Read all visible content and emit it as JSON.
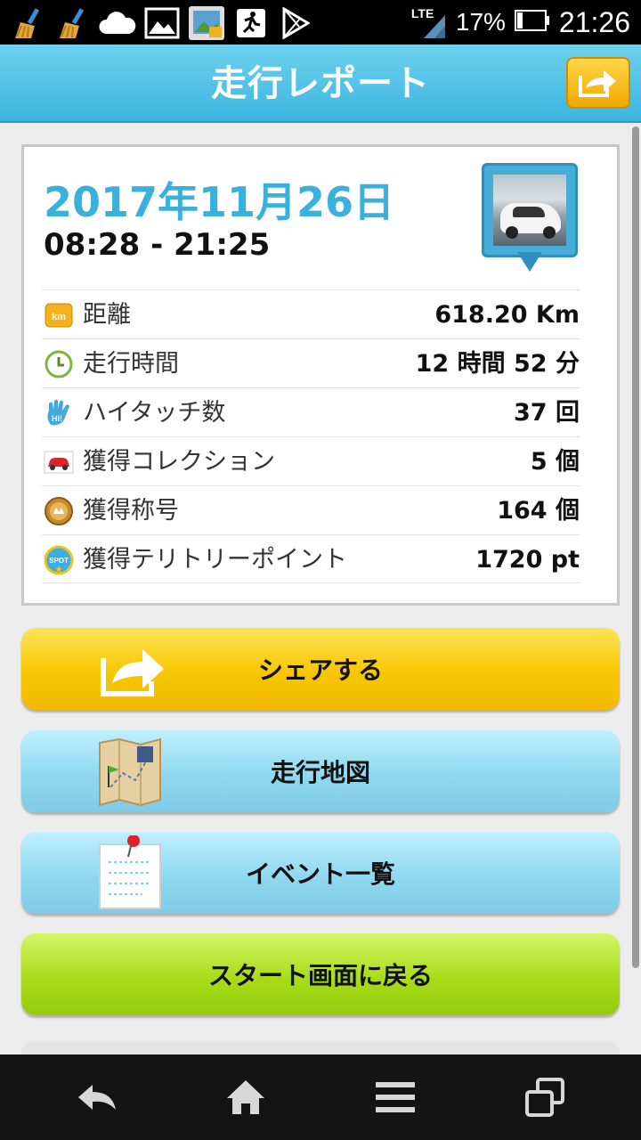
{
  "status_bar": {
    "network": "LTE",
    "battery": "17%",
    "time": "21:26",
    "icons": [
      "broom-icon",
      "broom-icon",
      "cloud-icon",
      "image-icon",
      "photo-icon",
      "running-icon",
      "play-store-icon"
    ]
  },
  "header": {
    "title": "走行レポート",
    "share_icon": "share-icon"
  },
  "report": {
    "date": "2017年11月26日",
    "time_range": "08:28 - 21:25",
    "stats": [
      {
        "icon": "km-icon",
        "label": "距離",
        "value": "618.20 Km"
      },
      {
        "icon": "clock-icon",
        "label": "走行時間",
        "value": "12 時間 52 分"
      },
      {
        "icon": "hi-hand-icon",
        "label": "ハイタッチ数",
        "value": "37 回"
      },
      {
        "icon": "car-icon",
        "label": "獲得コレクション",
        "value": "5 個"
      },
      {
        "icon": "medal-icon",
        "label": "獲得称号",
        "value": "164 個"
      },
      {
        "icon": "spot-icon",
        "label": "獲得テリトリーポイント",
        "value": "1720 pt"
      }
    ]
  },
  "buttons": {
    "share": "シェアする",
    "map": "走行地図",
    "events": "イベント一覧",
    "start": "スタート画面に戻る"
  },
  "colors": {
    "header": "#3cb6df",
    "date": "#3bb0da",
    "share_button": "#f7c700",
    "map_button": "#8fd8f0",
    "start_button": "#a8dc18"
  }
}
